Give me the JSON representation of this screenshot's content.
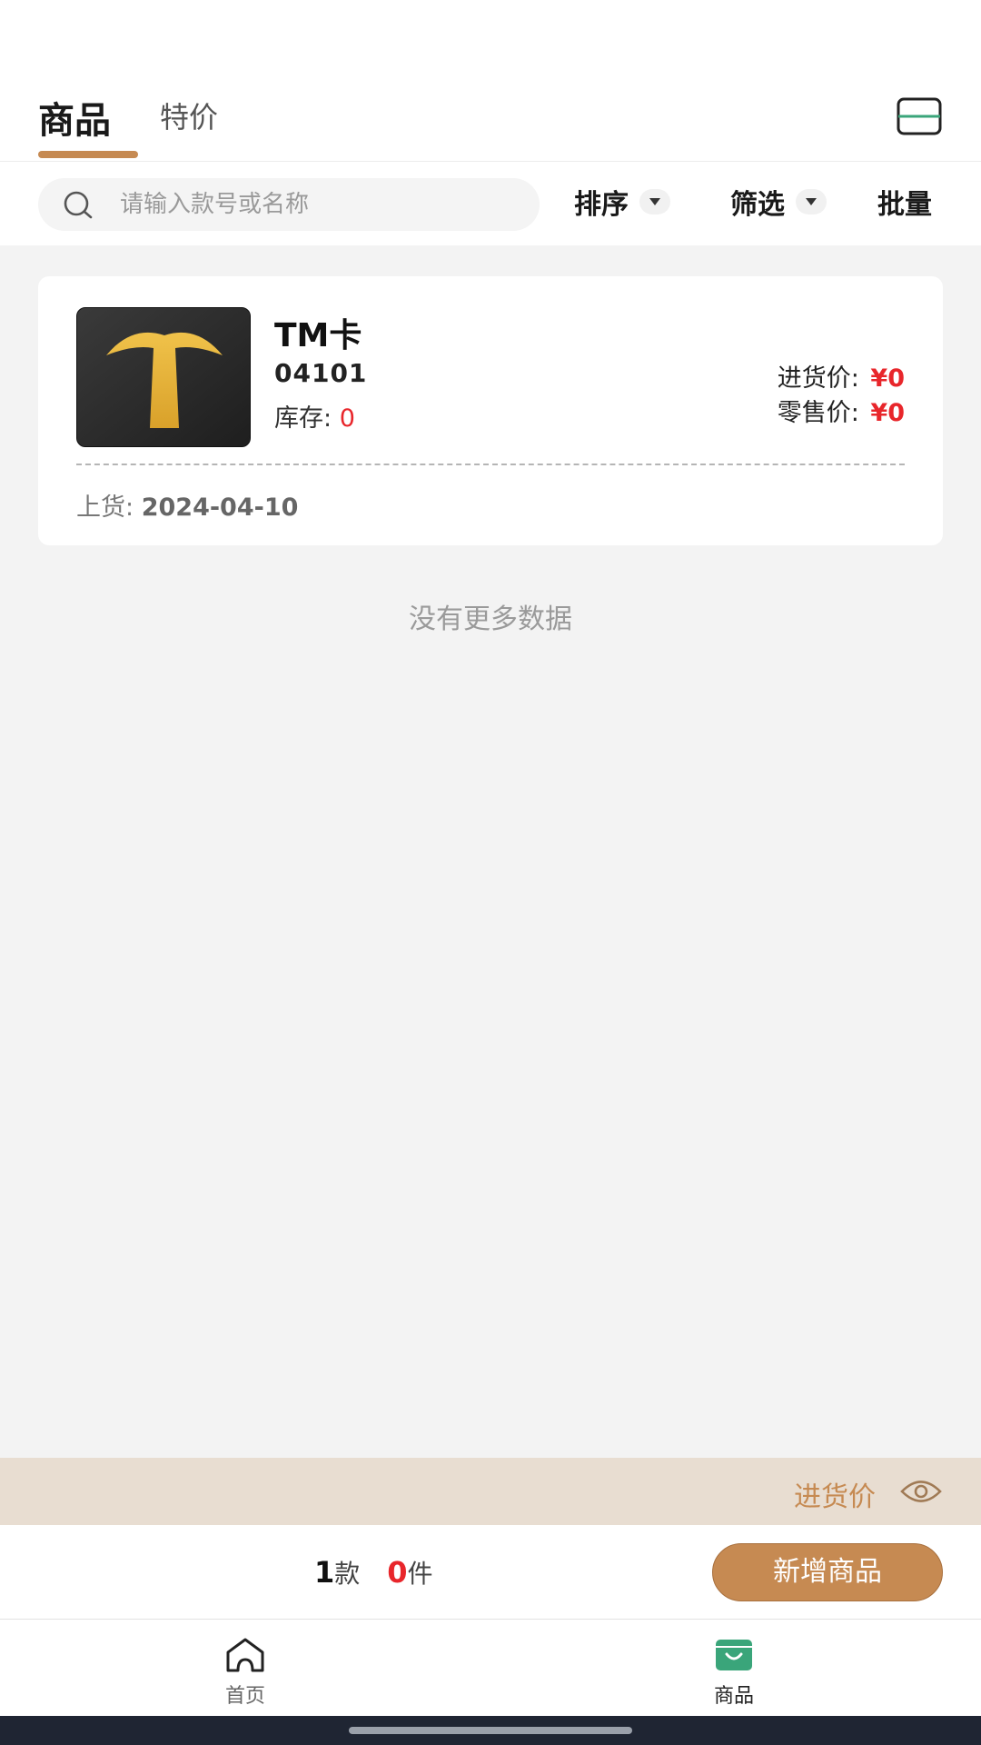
{
  "header": {
    "tabs": [
      {
        "label": "商品",
        "active": true
      },
      {
        "label": "特价",
        "active": false
      }
    ],
    "scan_icon": "scan-icon"
  },
  "toolbar": {
    "search_placeholder": "请输入款号或名称",
    "search_value": "",
    "sort_label": "排序",
    "filter_label": "筛选",
    "batch_label": "批量"
  },
  "products": [
    {
      "name": "TM卡",
      "code": "04101",
      "stock_label": "库存:",
      "stock_value": "0",
      "purchase_price_label": "进货价:",
      "purchase_price": "¥0",
      "retail_price_label": "零售价:",
      "retail_price": "¥0",
      "shelf_label": "上货:",
      "shelf_date": "2024-04-10"
    }
  ],
  "list_end_text": "没有更多数据",
  "price_toggle": {
    "label": "进货价",
    "icon": "eye-icon"
  },
  "summary": {
    "styles_count": "1",
    "styles_unit": "款",
    "pieces_count": "0",
    "pieces_unit": "件"
  },
  "add_button_label": "新增商品",
  "bottom_nav": [
    {
      "label": "首页",
      "icon": "home-icon",
      "active": false
    },
    {
      "label": "商品",
      "icon": "shop-bag-icon",
      "active": true
    }
  ],
  "colors": {
    "accent": "#c68a52",
    "price_red": "#e8262b",
    "nav_green": "#3aa57a",
    "toggle_bar_bg": "#e8ddd1"
  }
}
